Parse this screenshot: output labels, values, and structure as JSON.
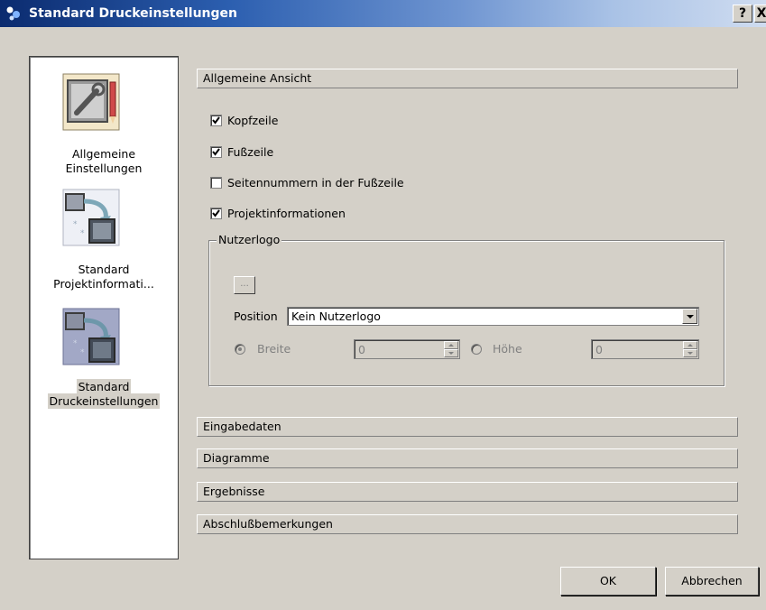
{
  "window": {
    "title": "Standard Druckeinstellungen",
    "help_label": "?",
    "close_label": "X"
  },
  "nav": {
    "items": [
      {
        "label_line1": "Allgemeine",
        "label_line2": "Einstellungen",
        "icon": "tools-icon"
      },
      {
        "label_line1": "Standard",
        "label_line2": "Projektinformati...",
        "icon": "transfer-icon"
      },
      {
        "label_line1": "Standard",
        "label_line2": "Druckeinstellungen",
        "icon": "transfer-icon",
        "selected": true
      }
    ]
  },
  "sections": {
    "general": "Allgemeine Ansicht",
    "input": "Eingabedaten",
    "diagrams": "Diagramme",
    "results": "Ergebnisse",
    "remarks": "Abschlußbemerkungen"
  },
  "options": [
    {
      "label": "Kopfzeile",
      "checked": true
    },
    {
      "label": "Fußzeile",
      "checked": true
    },
    {
      "label": "Seitennummern in der Fußzeile",
      "checked": false
    },
    {
      "label": "Projektinformationen",
      "checked": true
    }
  ],
  "logo": {
    "group_label": "Nutzerlogo",
    "browse_label": "...",
    "position_label": "Position",
    "position_value": "Kein Nutzerlogo",
    "width_label": "Breite",
    "width_value": "0",
    "height_label": "Höhe",
    "height_value": "0"
  },
  "buttons": {
    "ok": "OK",
    "cancel": "Abbrechen"
  }
}
